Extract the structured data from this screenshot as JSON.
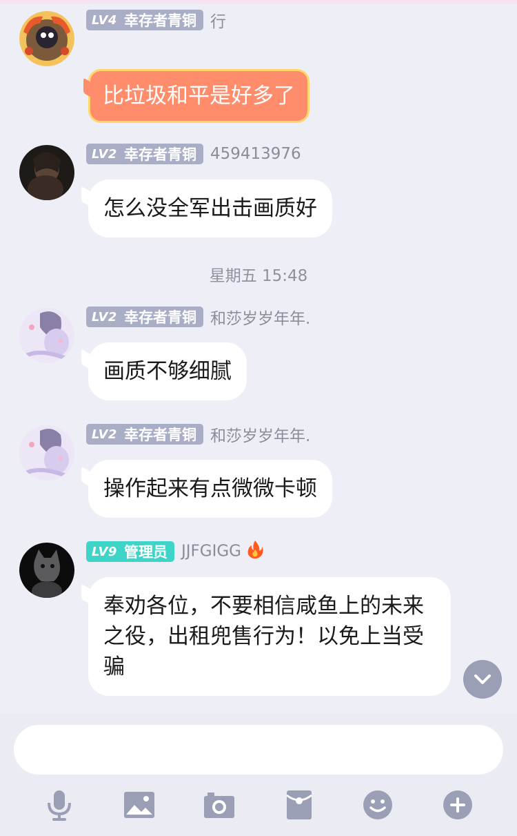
{
  "messages": [
    {
      "level": "LV4",
      "title": "幸存者青铜",
      "nickname": "行",
      "text": "比垃圾和平是好多了",
      "special_bubble": true
    },
    {
      "level": "LV2",
      "title": "幸存者青铜",
      "nickname": "459413976",
      "text": "怎么没全军出击画质好"
    },
    {
      "level": "LV2",
      "title": "幸存者青铜",
      "nickname": "和莎岁岁年年.",
      "text": "画质不够细腻"
    },
    {
      "level": "LV2",
      "title": "幸存者青铜",
      "nickname": "和莎岁岁年年.",
      "text": "操作起来有点微微卡顿"
    },
    {
      "level": "LV9",
      "title": "管理员",
      "nickname": "JJFGIGG",
      "text": "奉劝各位，不要相信咸鱼上的未来之役，出租兜售行为！以免上当受骗"
    }
  ],
  "timestamp": "星期五 15:48",
  "input": {
    "placeholder": ""
  },
  "toolbar": {
    "icons": [
      "microphone-icon",
      "image-icon",
      "camera-icon",
      "red-packet-icon",
      "emoji-icon",
      "plus-icon"
    ]
  },
  "colors": {
    "background": "#eeeef7",
    "badge_default": "#a9adc5",
    "badge_admin": "#3ed4c8",
    "special_bubble": "#ff8d6b",
    "special_bubble_border": "#ffd76a",
    "icon": "#9a9fb6"
  }
}
